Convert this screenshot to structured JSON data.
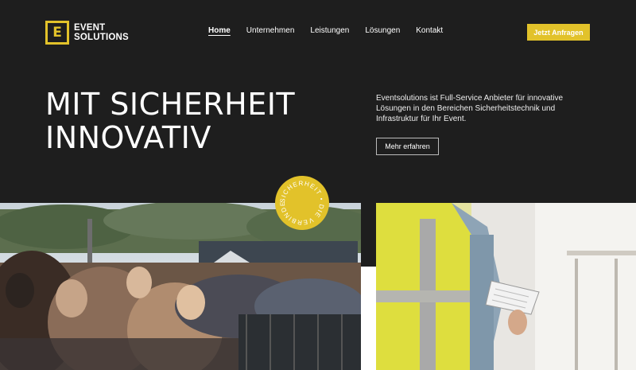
{
  "brand": {
    "mark": "E",
    "line1": "EVENT",
    "line2": "SOLUTIONS"
  },
  "nav": {
    "items": [
      {
        "label": "Home",
        "active": true
      },
      {
        "label": "Unternehmen",
        "active": false
      },
      {
        "label": "Leistungen",
        "active": false
      },
      {
        "label": "Lösungen",
        "active": false
      },
      {
        "label": "Kontakt",
        "active": false
      }
    ]
  },
  "header": {
    "cta_label": "Jetzt Anfragen"
  },
  "hero": {
    "title_line1": "MIT SICHERHEIT",
    "title_line2": "INNOVATIV",
    "description": "Eventsolutions ist Full-Service Anbieter für innovative Lösungen in den Bereichen Sicherheitstechnik und Infrastruktur für Ihr Event.",
    "more_label": "Mehr erfahren"
  },
  "badge": {
    "text": "SICHERHEIT • DIE VERBINDET • "
  },
  "colors": {
    "accent": "#e2c22a",
    "background": "#1e1e1e",
    "text": "#ffffff"
  },
  "images": {
    "left": "concert-crowd-photo",
    "right": "safety-vest-worker-photo"
  }
}
